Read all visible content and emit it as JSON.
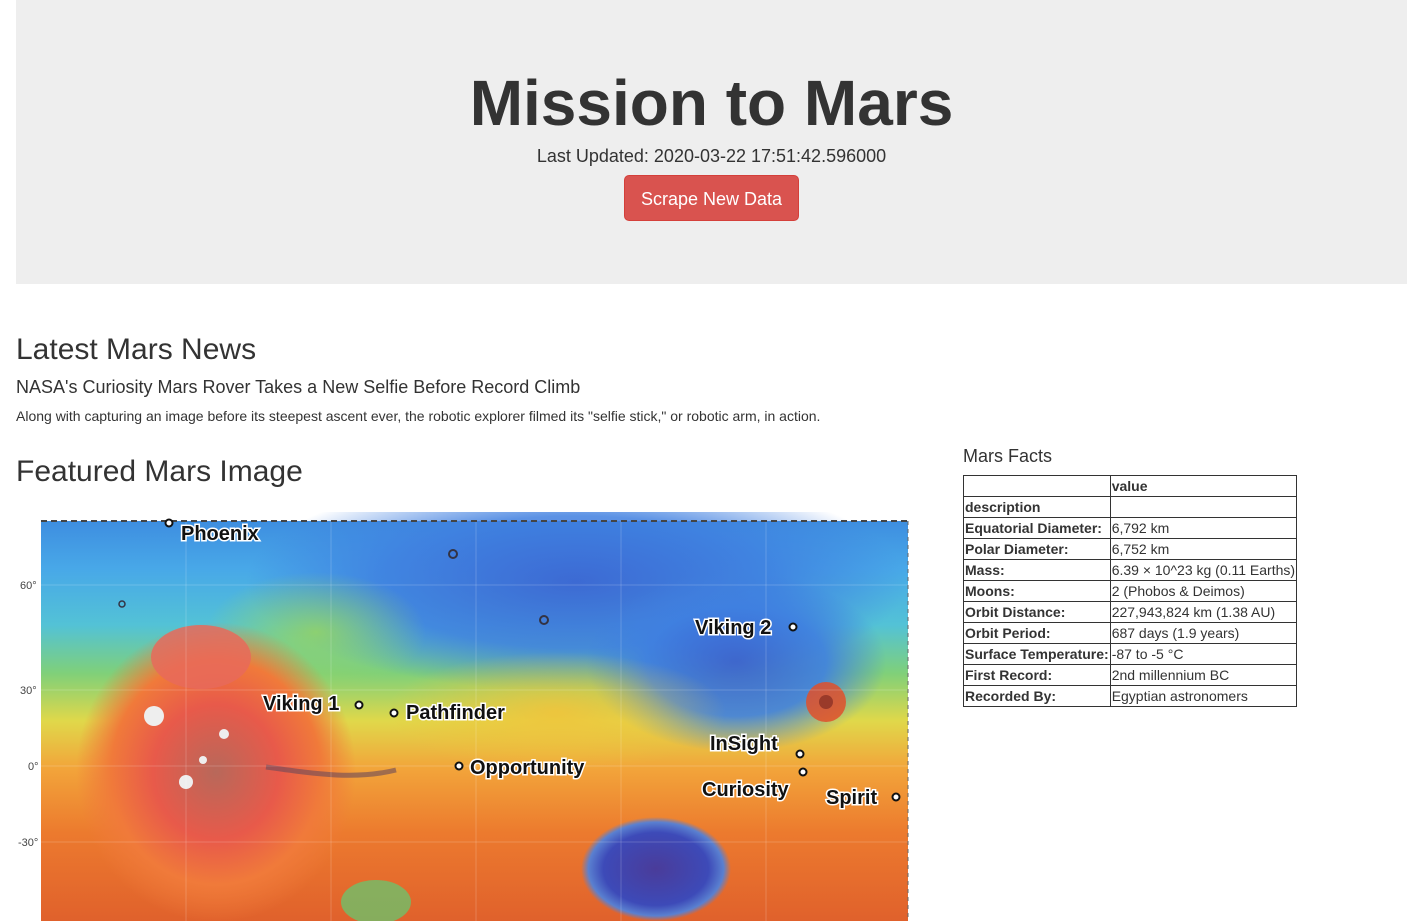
{
  "header": {
    "title": "Mission to Mars",
    "last_updated": "Last Updated: 2020-03-22 17:51:42.596000",
    "scrape_button": "Scrape New Data"
  },
  "news": {
    "section_title": "Latest Mars News",
    "headline": "NASA's Curiosity Mars Rover Takes a New Selfie Before Record Climb",
    "teaser": "Along with capturing an image before its steepest ascent ever, the robotic explorer filmed its \"selfie stick,\" or robotic arm, in action."
  },
  "featured_image": {
    "section_title": "Featured Mars Image",
    "latitude_labels": [
      "60°",
      "30°",
      "0°",
      "-30°"
    ],
    "sites": [
      "Phoenix",
      "Viking 2",
      "Viking 1",
      "Pathfinder",
      "InSight",
      "Opportunity",
      "Curiosity",
      "Spirit"
    ]
  },
  "facts": {
    "section_title": "Mars Facts",
    "header_col": "value",
    "rows": [
      {
        "label": "description",
        "value": ""
      },
      {
        "label": "Equatorial Diameter:",
        "value": "6,792 km"
      },
      {
        "label": "Polar Diameter:",
        "value": "6,752 km"
      },
      {
        "label": "Mass:",
        "value": "6.39 × 10^23 kg (0.11 Earths)"
      },
      {
        "label": "Moons:",
        "value": "2 (Phobos & Deimos)"
      },
      {
        "label": "Orbit Distance:",
        "value": "227,943,824 km (1.38 AU)"
      },
      {
        "label": "Orbit Period:",
        "value": "687 days (1.9 years)"
      },
      {
        "label": "Surface Temperature:",
        "value": "-87 to -5 °C"
      },
      {
        "label": "First Record:",
        "value": "2nd millennium BC"
      },
      {
        "label": "Recorded By:",
        "value": "Egyptian astronomers"
      }
    ]
  },
  "colors": {
    "jumbotron_bg": "#eeeeee",
    "button_bg": "#d9534f",
    "text": "#333333"
  }
}
